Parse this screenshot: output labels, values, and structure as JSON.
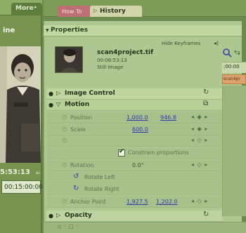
{
  "left_pane": {
    "more_tab": "More",
    "label": "ine",
    "timecode": "5:53:13",
    "duration": "00:15:00:00"
  },
  "top_tabs": {
    "how_to": "How To",
    "history": "History"
  },
  "properties": {
    "title": "Properties",
    "hide_keyframes": "Hide Keyframes",
    "clip": {
      "name": "scan4project.tif",
      "duration": "00:06:53:13",
      "type": "Still Image"
    },
    "timeline": {
      "time": ";00:00",
      "clip_label": "scan4pr"
    },
    "sections": {
      "image_control": "Image Control",
      "motion": "Motion",
      "opacity": "Opacity"
    },
    "motion": {
      "position_label": "Position",
      "position_x": "1,000.0",
      "position_y": "946.8",
      "scale_label": "Scale",
      "scale_value": "600.0",
      "constrain_label": "Constrain proportions",
      "constrain_checked": true,
      "rotation_label": "Rotation",
      "rotation_value": "0.0°",
      "rotate_left": "Rotate Left",
      "rotate_right": "Rotate Right",
      "anchor_label": "Anchor Point",
      "anchor_x": "1,927.5",
      "anchor_y": "1,202.0"
    }
  },
  "colors": {
    "panel_bg": "#aec690",
    "value_link": "#3338b0",
    "tab_how_to": "#bd6f74"
  }
}
